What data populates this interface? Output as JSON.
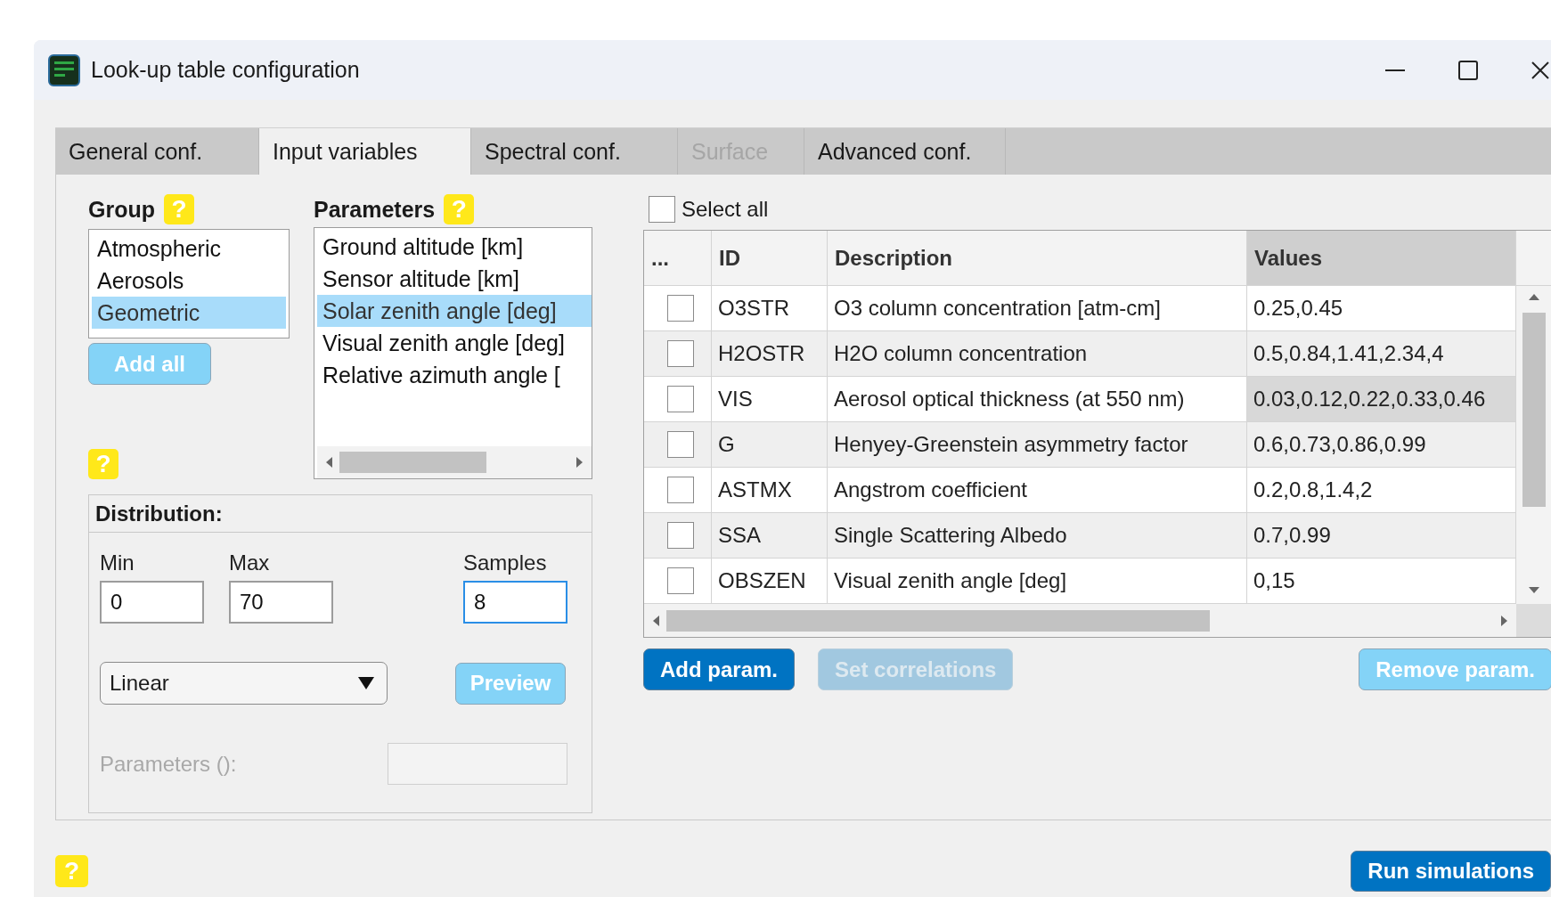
{
  "window": {
    "title": "Look-up table configuration"
  },
  "tabs": [
    {
      "label": "General conf.",
      "selected": false,
      "disabled": false
    },
    {
      "label": "Input variables",
      "selected": true,
      "disabled": false
    },
    {
      "label": "Spectral conf.",
      "selected": false,
      "disabled": false
    },
    {
      "label": "Surface",
      "selected": false,
      "disabled": true
    },
    {
      "label": "Advanced conf.",
      "selected": false,
      "disabled": false
    }
  ],
  "group": {
    "heading": "Group",
    "help": "?",
    "add_all": {
      "label": "Add all",
      "kind": "secondary"
    },
    "items": [
      {
        "label": "Atmospheric",
        "selected": false
      },
      {
        "label": "Aerosols",
        "selected": false
      },
      {
        "label": "Geometric",
        "selected": true
      }
    ]
  },
  "parameters": {
    "heading": "Parameters",
    "help": "?",
    "items": [
      {
        "label": "Ground altitude [km]",
        "selected": false
      },
      {
        "label": "Sensor altitude [km]",
        "selected": false
      },
      {
        "label": "Solar zenith angle [deg]",
        "selected": true
      },
      {
        "label": "Visual zenith angle [deg]",
        "selected": false
      },
      {
        "label": "Relative azimuth angle [",
        "selected": false
      }
    ]
  },
  "distribution": {
    "help": "?",
    "heading": "Distribution:",
    "min": {
      "label": "Min",
      "value": "0",
      "focused": false
    },
    "max": {
      "label": "Max",
      "value": "70",
      "focused": false
    },
    "samples": {
      "label": "Samples",
      "value": "8",
      "focused": true
    },
    "type": {
      "value": "Linear"
    },
    "preview": {
      "label": "Preview",
      "kind": "secondary"
    },
    "parameters": {
      "label": "Parameters ():",
      "disabled": true
    }
  },
  "select_all": {
    "label": "Select all",
    "checked": false
  },
  "table": {
    "columns": [
      {
        "label": "...",
        "sorted": false
      },
      {
        "label": "ID",
        "sorted": false
      },
      {
        "label": "Description",
        "sorted": false
      },
      {
        "label": "Values",
        "sorted": true
      }
    ],
    "rows": [
      {
        "checked": false,
        "id": "O3STR",
        "description": "O3 column concentration [atm-cm]",
        "values": "0.25,0.45",
        "selected": false
      },
      {
        "checked": false,
        "id": "H2OSTR",
        "description": "H2O column concentration",
        "values": "0.5,0.84,1.41,2.34,4",
        "selected": false
      },
      {
        "checked": false,
        "id": "VIS",
        "description": "Aerosol optical thickness (at 550 nm)",
        "values": "0.03,0.12,0.22,0.33,0.46",
        "selected": true
      },
      {
        "checked": false,
        "id": "G",
        "description": "Henyey-Greenstein asymmetry factor",
        "values": "0.6,0.73,0.86,0.99",
        "selected": false
      },
      {
        "checked": false,
        "id": "ASTMX",
        "description": "Angstrom coefficient",
        "values": "0.2,0.8,1.4,2",
        "selected": false
      },
      {
        "checked": false,
        "id": "SSA",
        "description": "Single Scattering Albedo",
        "values": "0.7,0.99",
        "selected": false
      },
      {
        "checked": false,
        "id": "OBSZEN",
        "description": "Visual zenith angle [deg]",
        "values": "0,15",
        "selected": false
      }
    ]
  },
  "buttons": [
    {
      "label": "Add param.",
      "kind": "primary",
      "disabled": false
    },
    {
      "label": "Set correlations",
      "kind": "secondary",
      "disabled": true
    },
    {
      "label": "Remove param.",
      "kind": "secondary",
      "disabled": false
    }
  ],
  "footer": {
    "help": "?",
    "run": {
      "label": "Run simulations",
      "kind": "primary"
    }
  }
}
